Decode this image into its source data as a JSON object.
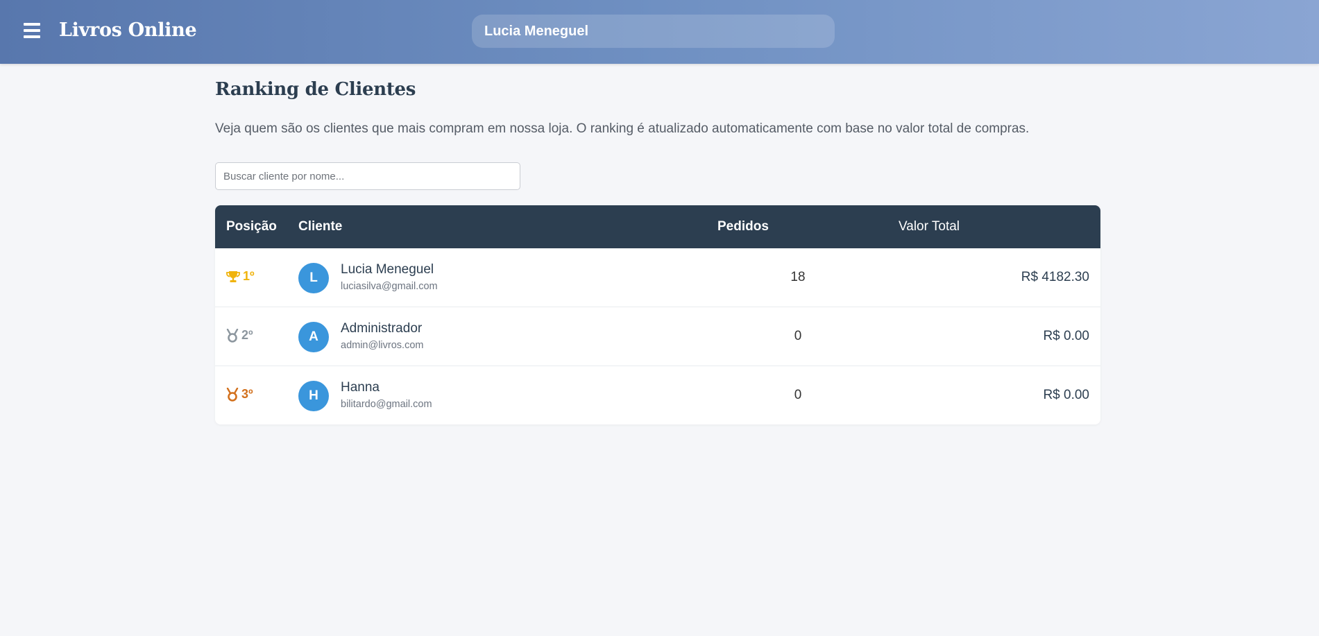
{
  "header": {
    "brand": "Livros Online",
    "user_name": "Lucia Meneguel"
  },
  "page": {
    "title": "Ranking de Clientes",
    "description": "Veja quem são os clientes que mais compram em nossa loja. O ranking é atualizado automaticamente com base no valor total de compras."
  },
  "search": {
    "placeholder": "Buscar cliente por nome..."
  },
  "table": {
    "columns": [
      "Posição",
      "Cliente",
      "Pedidos",
      "Valor Total"
    ],
    "rows": [
      {
        "position": "1º",
        "icon": "trophy-icon",
        "color": "#f0b30c",
        "initial": "L",
        "name": "Lucia Meneguel",
        "email": "luciasilva@gmail.com",
        "orders": "18",
        "total": "R$ 4182.30"
      },
      {
        "position": "2º",
        "icon": "silver-medal-icon",
        "color": "#8c969e",
        "initial": "A",
        "name": "Administrador",
        "email": "admin@livros.com",
        "orders": "0",
        "total": "R$ 0.00"
      },
      {
        "position": "3º",
        "icon": "bronze-medal-icon",
        "color": "#d2701c",
        "initial": "H",
        "name": "Hanna",
        "email": "bilitardo@gmail.com",
        "orders": "0",
        "total": "R$ 0.00"
      }
    ]
  },
  "colors": {
    "header_gradient_start": "#5877ad",
    "header_gradient_end": "#8aa5d3",
    "table_header": "#2c3e50",
    "avatar": "#3a96dc",
    "gold": "#f0b30c",
    "silver": "#8c969e",
    "bronze": "#d2701c"
  }
}
